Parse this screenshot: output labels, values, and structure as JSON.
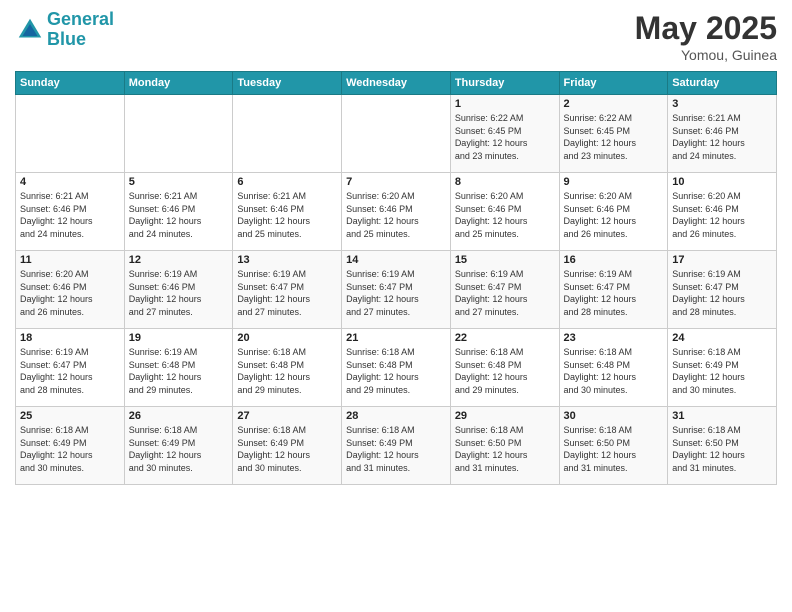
{
  "header": {
    "logo_line1": "General",
    "logo_line2": "Blue",
    "title": "May 2025",
    "subtitle": "Yomou, Guinea"
  },
  "days_of_week": [
    "Sunday",
    "Monday",
    "Tuesday",
    "Wednesday",
    "Thursday",
    "Friday",
    "Saturday"
  ],
  "weeks": [
    [
      {
        "day": "",
        "info": ""
      },
      {
        "day": "",
        "info": ""
      },
      {
        "day": "",
        "info": ""
      },
      {
        "day": "",
        "info": ""
      },
      {
        "day": "1",
        "info": "Sunrise: 6:22 AM\nSunset: 6:45 PM\nDaylight: 12 hours\nand 23 minutes."
      },
      {
        "day": "2",
        "info": "Sunrise: 6:22 AM\nSunset: 6:45 PM\nDaylight: 12 hours\nand 23 minutes."
      },
      {
        "day": "3",
        "info": "Sunrise: 6:21 AM\nSunset: 6:46 PM\nDaylight: 12 hours\nand 24 minutes."
      }
    ],
    [
      {
        "day": "4",
        "info": "Sunrise: 6:21 AM\nSunset: 6:46 PM\nDaylight: 12 hours\nand 24 minutes."
      },
      {
        "day": "5",
        "info": "Sunrise: 6:21 AM\nSunset: 6:46 PM\nDaylight: 12 hours\nand 24 minutes."
      },
      {
        "day": "6",
        "info": "Sunrise: 6:21 AM\nSunset: 6:46 PM\nDaylight: 12 hours\nand 25 minutes."
      },
      {
        "day": "7",
        "info": "Sunrise: 6:20 AM\nSunset: 6:46 PM\nDaylight: 12 hours\nand 25 minutes."
      },
      {
        "day": "8",
        "info": "Sunrise: 6:20 AM\nSunset: 6:46 PM\nDaylight: 12 hours\nand 25 minutes."
      },
      {
        "day": "9",
        "info": "Sunrise: 6:20 AM\nSunset: 6:46 PM\nDaylight: 12 hours\nand 26 minutes."
      },
      {
        "day": "10",
        "info": "Sunrise: 6:20 AM\nSunset: 6:46 PM\nDaylight: 12 hours\nand 26 minutes."
      }
    ],
    [
      {
        "day": "11",
        "info": "Sunrise: 6:20 AM\nSunset: 6:46 PM\nDaylight: 12 hours\nand 26 minutes."
      },
      {
        "day": "12",
        "info": "Sunrise: 6:19 AM\nSunset: 6:46 PM\nDaylight: 12 hours\nand 27 minutes."
      },
      {
        "day": "13",
        "info": "Sunrise: 6:19 AM\nSunset: 6:47 PM\nDaylight: 12 hours\nand 27 minutes."
      },
      {
        "day": "14",
        "info": "Sunrise: 6:19 AM\nSunset: 6:47 PM\nDaylight: 12 hours\nand 27 minutes."
      },
      {
        "day": "15",
        "info": "Sunrise: 6:19 AM\nSunset: 6:47 PM\nDaylight: 12 hours\nand 27 minutes."
      },
      {
        "day": "16",
        "info": "Sunrise: 6:19 AM\nSunset: 6:47 PM\nDaylight: 12 hours\nand 28 minutes."
      },
      {
        "day": "17",
        "info": "Sunrise: 6:19 AM\nSunset: 6:47 PM\nDaylight: 12 hours\nand 28 minutes."
      }
    ],
    [
      {
        "day": "18",
        "info": "Sunrise: 6:19 AM\nSunset: 6:47 PM\nDaylight: 12 hours\nand 28 minutes."
      },
      {
        "day": "19",
        "info": "Sunrise: 6:19 AM\nSunset: 6:48 PM\nDaylight: 12 hours\nand 29 minutes."
      },
      {
        "day": "20",
        "info": "Sunrise: 6:18 AM\nSunset: 6:48 PM\nDaylight: 12 hours\nand 29 minutes."
      },
      {
        "day": "21",
        "info": "Sunrise: 6:18 AM\nSunset: 6:48 PM\nDaylight: 12 hours\nand 29 minutes."
      },
      {
        "day": "22",
        "info": "Sunrise: 6:18 AM\nSunset: 6:48 PM\nDaylight: 12 hours\nand 29 minutes."
      },
      {
        "day": "23",
        "info": "Sunrise: 6:18 AM\nSunset: 6:48 PM\nDaylight: 12 hours\nand 30 minutes."
      },
      {
        "day": "24",
        "info": "Sunrise: 6:18 AM\nSunset: 6:49 PM\nDaylight: 12 hours\nand 30 minutes."
      }
    ],
    [
      {
        "day": "25",
        "info": "Sunrise: 6:18 AM\nSunset: 6:49 PM\nDaylight: 12 hours\nand 30 minutes."
      },
      {
        "day": "26",
        "info": "Sunrise: 6:18 AM\nSunset: 6:49 PM\nDaylight: 12 hours\nand 30 minutes."
      },
      {
        "day": "27",
        "info": "Sunrise: 6:18 AM\nSunset: 6:49 PM\nDaylight: 12 hours\nand 30 minutes."
      },
      {
        "day": "28",
        "info": "Sunrise: 6:18 AM\nSunset: 6:49 PM\nDaylight: 12 hours\nand 31 minutes."
      },
      {
        "day": "29",
        "info": "Sunrise: 6:18 AM\nSunset: 6:50 PM\nDaylight: 12 hours\nand 31 minutes."
      },
      {
        "day": "30",
        "info": "Sunrise: 6:18 AM\nSunset: 6:50 PM\nDaylight: 12 hours\nand 31 minutes."
      },
      {
        "day": "31",
        "info": "Sunrise: 6:18 AM\nSunset: 6:50 PM\nDaylight: 12 hours\nand 31 minutes."
      }
    ]
  ]
}
